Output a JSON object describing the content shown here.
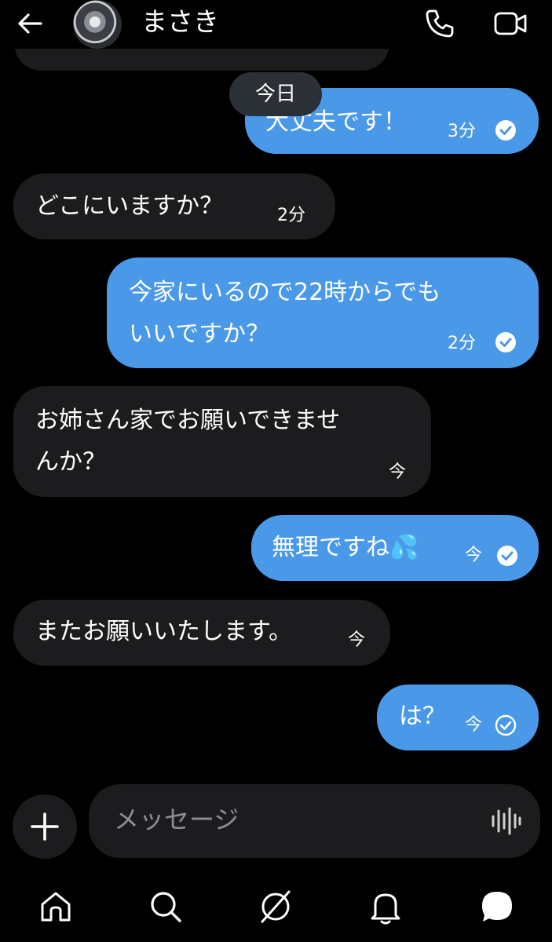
{
  "header": {
    "contact_name": "まさき",
    "icons": {
      "back": "arrow-left-icon",
      "call": "phone-icon",
      "video": "video-camera-icon"
    }
  },
  "date_separator": "今日",
  "messages": [
    {
      "dir": "out",
      "text": "大丈夫です！",
      "time": "3分",
      "status": "read"
    },
    {
      "dir": "in",
      "text": "どこにいますか？",
      "time": "2分"
    },
    {
      "dir": "out",
      "text_lines": [
        "今家にいるので22時からでも",
        "いいですか？"
      ],
      "time": "2分",
      "status": "read"
    },
    {
      "dir": "in",
      "text_lines": [
        "お姉さん家でお願いできませ",
        "んか？"
      ],
      "time": "今"
    },
    {
      "dir": "out",
      "text": "無理ですね💦",
      "time": "今",
      "status": "read"
    },
    {
      "dir": "in",
      "text": "またお願いいたします。",
      "time": "今"
    },
    {
      "dir": "out",
      "text": "は？",
      "time": "今",
      "status": "sent"
    }
  ],
  "composer": {
    "placeholder": "メッセージ",
    "icons": {
      "add": "plus-icon",
      "voice": "voice-waveform-icon"
    }
  },
  "bottom_nav": [
    "home-icon",
    "search-icon",
    "compass-icon",
    "bell-icon",
    "chat-bubble-icon"
  ],
  "colors": {
    "background": "#000000",
    "incoming_bubble": "#1c1c1e",
    "outgoing_bubble": "#4a98e8",
    "date_pill": "#2b3036"
  }
}
